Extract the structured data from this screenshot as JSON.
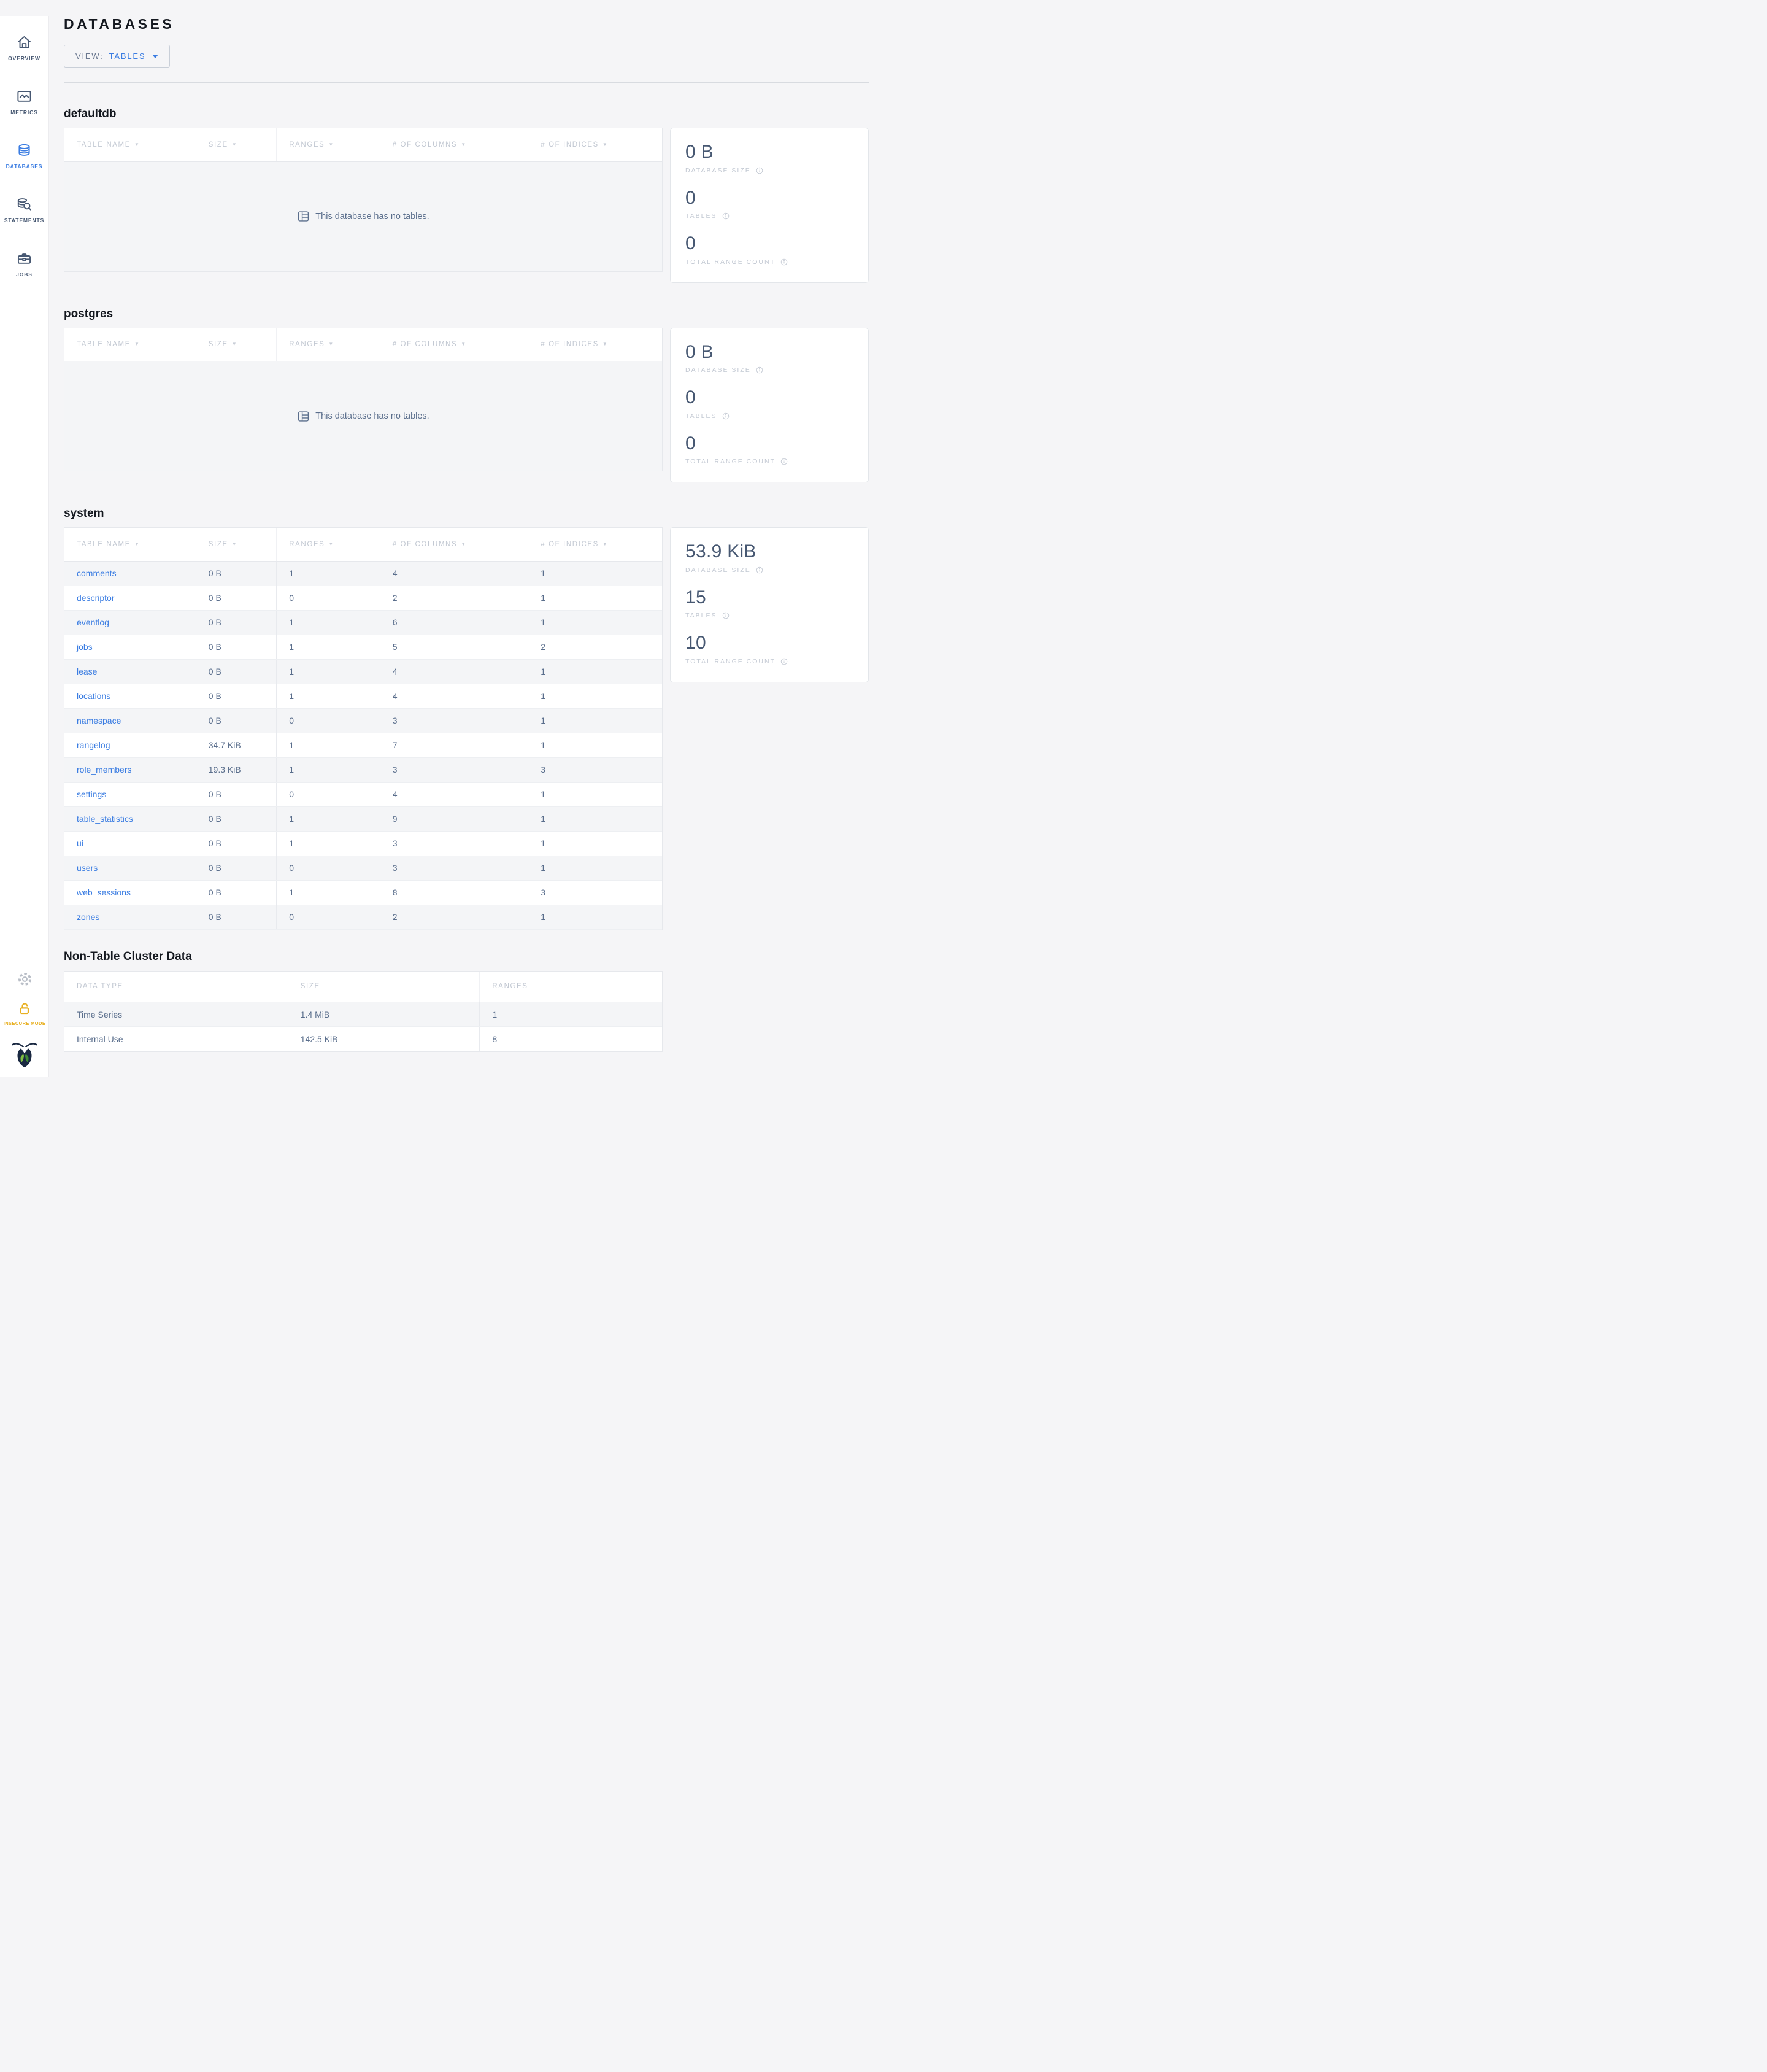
{
  "app": {
    "title": "DATABASES"
  },
  "view_control": {
    "label": "VIEW:",
    "value": "TABLES"
  },
  "sidebar": {
    "items": [
      {
        "id": "overview",
        "label": "OVERVIEW",
        "icon": "home-icon",
        "active": false
      },
      {
        "id": "metrics",
        "label": "METRICS",
        "icon": "metrics-icon",
        "active": false
      },
      {
        "id": "databases",
        "label": "DATABASES",
        "icon": "databases-icon",
        "active": true
      },
      {
        "id": "statements",
        "label": "STATEMENTS",
        "icon": "statements-icon",
        "active": false
      },
      {
        "id": "jobs",
        "label": "JOBS",
        "icon": "jobs-icon",
        "active": false
      }
    ],
    "footer": {
      "insecure_label": "INSECURE MODE"
    }
  },
  "columns": {
    "main": [
      "TABLE NAME",
      "SIZE",
      "RANGES",
      "# OF COLUMNS",
      "# OF INDICES"
    ],
    "non_table": [
      "DATA TYPE",
      "SIZE",
      "RANGES"
    ]
  },
  "stats_labels": {
    "size": "DATABASE SIZE",
    "tables": "TABLES",
    "ranges": "TOTAL RANGE COUNT"
  },
  "empty_message": "This database has no tables.",
  "databases": [
    {
      "name": "defaultdb",
      "empty": true,
      "stats": {
        "size": "0 B",
        "tables": "0",
        "ranges": "0"
      }
    },
    {
      "name": "postgres",
      "empty": true,
      "stats": {
        "size": "0 B",
        "tables": "0",
        "ranges": "0"
      }
    },
    {
      "name": "system",
      "empty": false,
      "rows": [
        {
          "name": "comments",
          "size": "0 B",
          "ranges": "1",
          "columns": "4",
          "indices": "1"
        },
        {
          "name": "descriptor",
          "size": "0 B",
          "ranges": "0",
          "columns": "2",
          "indices": "1"
        },
        {
          "name": "eventlog",
          "size": "0 B",
          "ranges": "1",
          "columns": "6",
          "indices": "1"
        },
        {
          "name": "jobs",
          "size": "0 B",
          "ranges": "1",
          "columns": "5",
          "indices": "2"
        },
        {
          "name": "lease",
          "size": "0 B",
          "ranges": "1",
          "columns": "4",
          "indices": "1"
        },
        {
          "name": "locations",
          "size": "0 B",
          "ranges": "1",
          "columns": "4",
          "indices": "1"
        },
        {
          "name": "namespace",
          "size": "0 B",
          "ranges": "0",
          "columns": "3",
          "indices": "1"
        },
        {
          "name": "rangelog",
          "size": "34.7 KiB",
          "ranges": "1",
          "columns": "7",
          "indices": "1"
        },
        {
          "name": "role_members",
          "size": "19.3 KiB",
          "ranges": "1",
          "columns": "3",
          "indices": "3"
        },
        {
          "name": "settings",
          "size": "0 B",
          "ranges": "0",
          "columns": "4",
          "indices": "1"
        },
        {
          "name": "table_statistics",
          "size": "0 B",
          "ranges": "1",
          "columns": "9",
          "indices": "1"
        },
        {
          "name": "ui",
          "size": "0 B",
          "ranges": "1",
          "columns": "3",
          "indices": "1"
        },
        {
          "name": "users",
          "size": "0 B",
          "ranges": "0",
          "columns": "3",
          "indices": "1"
        },
        {
          "name": "web_sessions",
          "size": "0 B",
          "ranges": "1",
          "columns": "8",
          "indices": "3"
        },
        {
          "name": "zones",
          "size": "0 B",
          "ranges": "0",
          "columns": "2",
          "indices": "1"
        }
      ],
      "stats": {
        "size": "53.9 KiB",
        "tables": "15",
        "ranges": "10"
      }
    }
  ],
  "non_table_section": {
    "title": "Non-Table Cluster Data",
    "rows": [
      {
        "type": "Time Series",
        "size": "1.4 MiB",
        "ranges": "1"
      },
      {
        "type": "Internal Use",
        "size": "142.5 KiB",
        "ranges": "8"
      }
    ]
  },
  "colors": {
    "accent_blue": "#3b7de2",
    "link_blue": "#3b7de2",
    "value_slate": "#475872",
    "cell_slate": "#5a6e8c",
    "header_gray": "#c2c8d2",
    "warning_yellow": "#e8b021",
    "page_background": "#f5f5f7"
  }
}
